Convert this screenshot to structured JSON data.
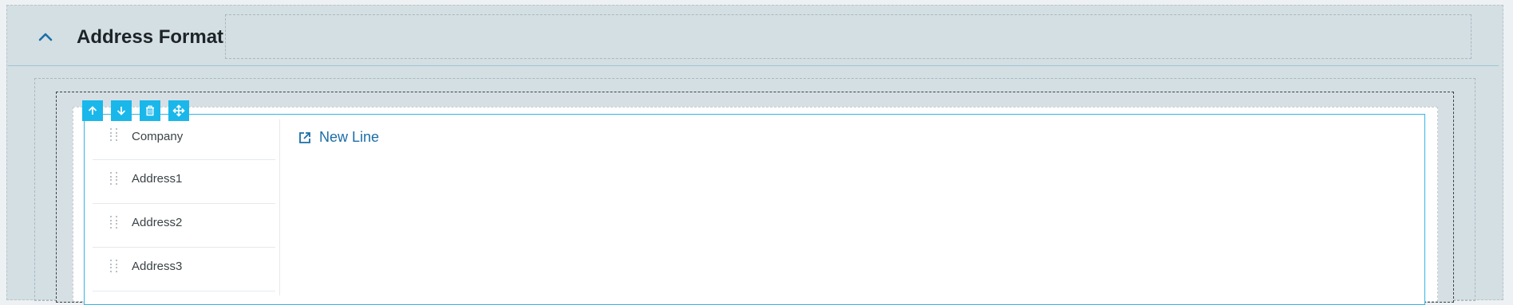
{
  "panel": {
    "title": "Address Format"
  },
  "toolbar": {
    "buttons": [
      {
        "icon": "arrow-up-icon",
        "action": "move-up"
      },
      {
        "icon": "arrow-down-icon",
        "action": "move-down"
      },
      {
        "icon": "trash-icon",
        "action": "delete"
      },
      {
        "icon": "move-icon",
        "action": "drag"
      }
    ]
  },
  "fields": [
    {
      "label": "Company"
    },
    {
      "label": "Address1"
    },
    {
      "label": "Address2"
    },
    {
      "label": "Address3"
    }
  ],
  "new_line": {
    "label": "New Line",
    "icon": "external-link-icon"
  },
  "colors": {
    "accent": "#1ab7ea",
    "link": "#1c6ea6",
    "panel_bg": "#d3dfe3",
    "title_text": "#1d2428"
  }
}
